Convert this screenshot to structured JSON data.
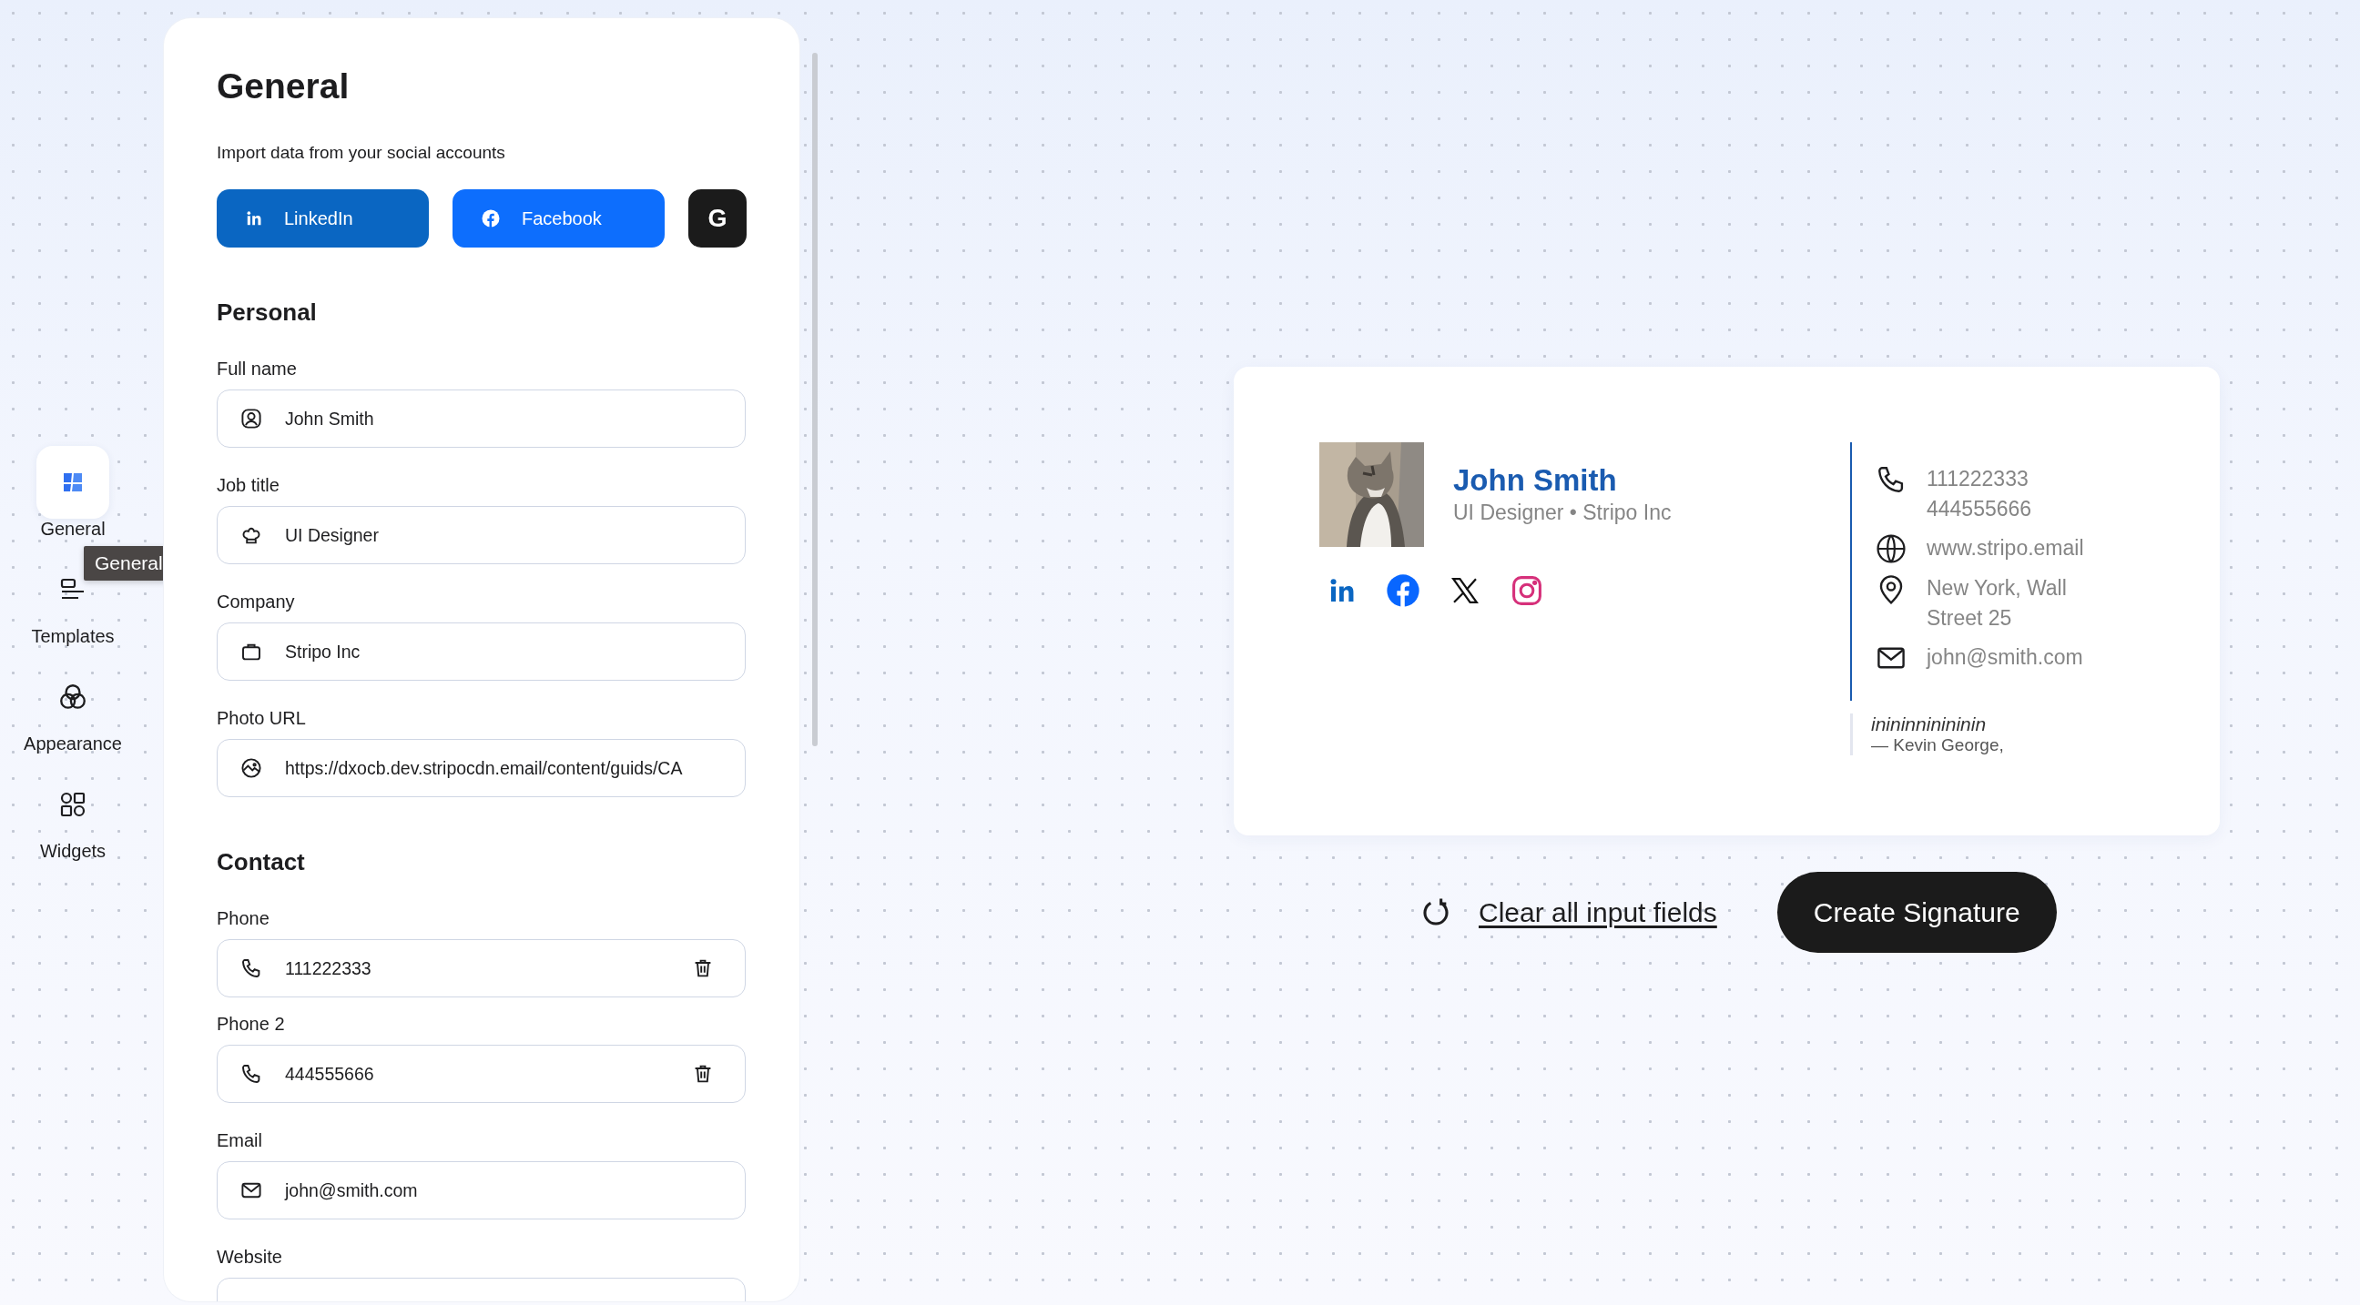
{
  "sidebar": {
    "items": [
      {
        "label": "General",
        "selected": true
      },
      {
        "label": "Templates",
        "selected": false
      },
      {
        "label": "Appearance",
        "selected": false
      },
      {
        "label": "Widgets",
        "selected": false
      }
    ],
    "tooltip": "General"
  },
  "panel": {
    "title": "General",
    "import_label": "Import data from your social accounts",
    "import_buttons": [
      {
        "kind": "linkedin",
        "label": "LinkedIn"
      },
      {
        "kind": "facebook",
        "label": "Facebook"
      },
      {
        "kind": "google",
        "label": "G"
      }
    ],
    "sections": [
      {
        "title": "Personal",
        "fields": [
          {
            "label": "Full name",
            "value": "John Smith",
            "kind": "user",
            "deletable": false
          },
          {
            "label": "Job title",
            "value": "UI Designer",
            "kind": "job",
            "deletable": false
          },
          {
            "label": "Company",
            "value": "Stripo Inc",
            "kind": "company",
            "deletable": false
          },
          {
            "label": "Photo URL",
            "value": "https://dxocb.dev.stripocdn.email/content/guids/CA",
            "deletable": false
          }
        ]
      },
      {
        "title": "Contact",
        "fields": [
          {
            "label": "Phone",
            "value": "111222333",
            "kind": "phone",
            "deletable": true
          },
          {
            "label": "Phone 2",
            "value": "444555666",
            "kind": "phone",
            "deletable": true
          },
          {
            "label": "Email",
            "value": "john@smith.com",
            "kind": "email",
            "deletable": false
          },
          {
            "label": "Website",
            "kind": "website",
            "deletable": false
          }
        ]
      }
    ]
  },
  "signature": {
    "name": "John Smith",
    "subtitle": "UI Designer • Stripo Inc",
    "socials": [
      {
        "kind": "linkedin"
      },
      {
        "kind": "facebook"
      },
      {
        "kind": "x"
      },
      {
        "kind": "instagram"
      }
    ],
    "contacts": [
      {
        "kind": "phone",
        "lines": [
          "111222333",
          "444555666"
        ]
      },
      {
        "kind": "web",
        "lines": [
          "www.stripo.email"
        ]
      },
      {
        "kind": "location",
        "lines": [
          "New York, Wall Street 25"
        ]
      },
      {
        "kind": "email",
        "lines": [
          "john@smith.com"
        ]
      }
    ],
    "quote": {
      "text": "inininninininin",
      "author": "— Kevin George,"
    }
  },
  "actions": {
    "clear_link": "Clear all input fields",
    "create_button": "Create Signature"
  }
}
